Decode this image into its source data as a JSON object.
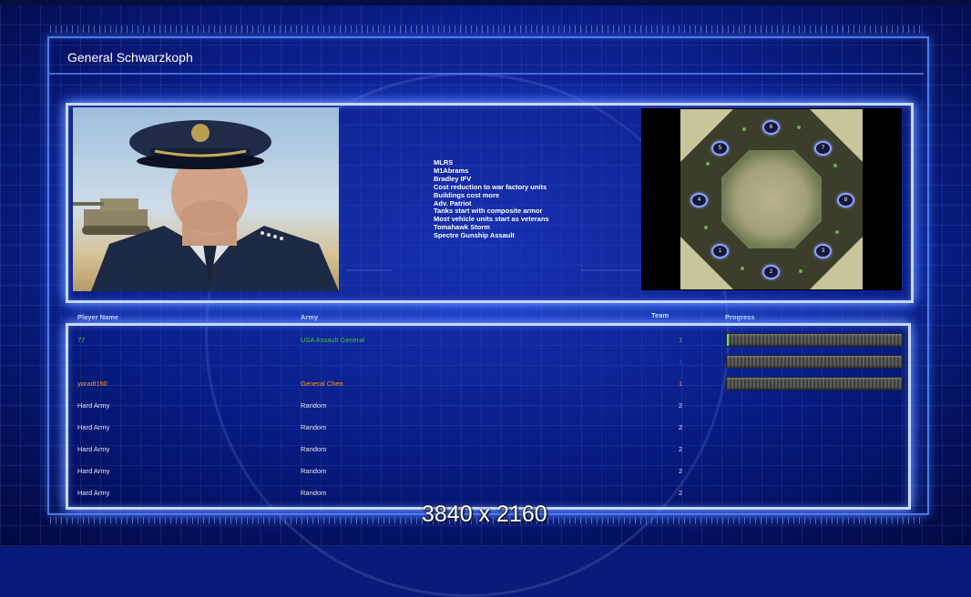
{
  "window": {
    "top_left_text": "",
    "top_right_text": ""
  },
  "general": {
    "title": "General Schwarzkoph",
    "traits": [
      "MLRS",
      "M1Abrams",
      "Bradley IFV",
      "Cost reduction to war factory units",
      "Buildings cost more",
      "Adv. Patriot",
      "Tanks start with composite armor",
      "Most vehicle units start as veterans",
      "Tomahawk Storm",
      "Spectre Gunship Assault"
    ],
    "portrait_icon": "general-portrait",
    "map_slots": [
      "1",
      "2",
      "3",
      "4",
      "5",
      "6",
      "7",
      "8"
    ]
  },
  "table": {
    "headers": {
      "player": "Player Name",
      "army": "Army",
      "team": "Team",
      "progress": "Progress"
    },
    "rows": [
      {
        "player": "77",
        "army": "USA Assault General",
        "team": "1",
        "color": "#46c83a",
        "progress": 0.01
      },
      {
        "player": "",
        "army": "",
        "team": "1",
        "color": "#2f56ff",
        "progress": 0.0
      },
      {
        "player": "yoradi160",
        "army": "General Chen",
        "team": "1",
        "color": "#ff9a1e",
        "progress": 0.0
      },
      {
        "player": "Hard Army",
        "army": "Random",
        "team": "2",
        "color": "#e8e8e8"
      },
      {
        "player": "Hard Army",
        "army": "Random",
        "team": "2",
        "color": "#e8e8e8"
      },
      {
        "player": "Hard Army",
        "army": "Random",
        "team": "2",
        "color": "#e8e8e8"
      },
      {
        "player": "Hard Army",
        "army": "Random",
        "team": "2",
        "color": "#e8e8e8"
      },
      {
        "player": "Hard Army",
        "army": "Random",
        "team": "2",
        "color": "#e8e8e8"
      }
    ]
  },
  "overlay": {
    "resolution": "3840 x 2160"
  }
}
